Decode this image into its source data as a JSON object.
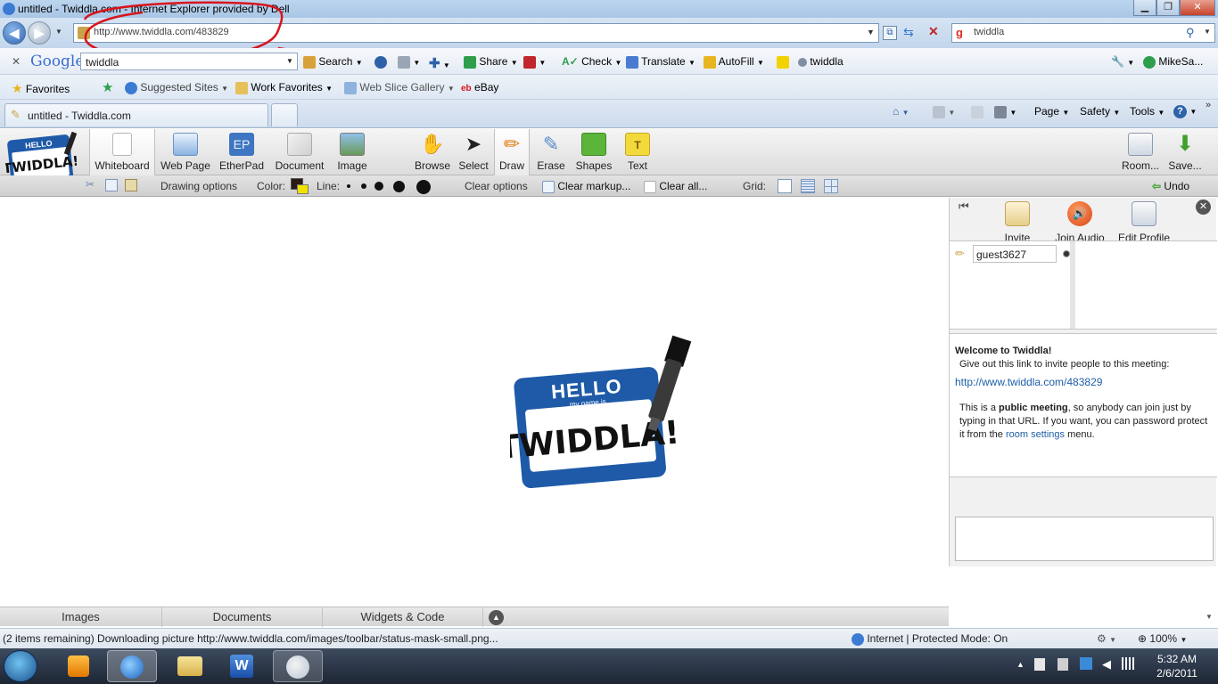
{
  "window": {
    "title": "untitled - Twiddla.com - Internet Explorer provided by Dell",
    "controls": [
      "minimize",
      "restore",
      "close"
    ]
  },
  "nav": {
    "url": "http://www.twiddla.com/483829",
    "search_value": "twiddla"
  },
  "google_toolbar": {
    "close": "✕",
    "brand": "Google",
    "query": "twiddla",
    "search_label": "Search",
    "share_label": "Share",
    "check_label": "Check",
    "translate_label": "Translate",
    "autofill_label": "AutoFill",
    "bookmark_label": "twiddla",
    "user_label": "MikeSa..."
  },
  "favorites_bar": {
    "favorites_label": "Favorites",
    "items": [
      "Suggested Sites",
      "Work Favorites",
      "Web Slice Gallery",
      "eBay"
    ]
  },
  "tabs": {
    "active_tab": "untitled - Twiddla.com",
    "commands": [
      "Page",
      "Safety",
      "Tools"
    ]
  },
  "twiddla_toolbar": {
    "logo_text": "HELLO TWIDDLA!",
    "modes": [
      "Whiteboard",
      "Web Page",
      "EtherPad",
      "Document",
      "Image"
    ],
    "tools": [
      "Browse",
      "Select",
      "Draw",
      "Erase",
      "Shapes",
      "Text"
    ],
    "ep_icon_text": "EP",
    "text_icon_text": "T",
    "room_label": "Room...",
    "save_label": "Save..."
  },
  "options_bar": {
    "drawing_options": "Drawing options",
    "color_label": "Color:",
    "line_label": "Line:",
    "clear_options": "Clear options",
    "clear_markup": "Clear markup...",
    "clear_all": "Clear all...",
    "grid_label": "Grid:",
    "undo_label": "Undo"
  },
  "canvas_logo": {
    "hello": "HELLO",
    "my_name_is": "my name is",
    "name": "TWIDDLA!"
  },
  "bottom_tabs": [
    "Images",
    "Documents",
    "Widgets & Code"
  ],
  "right_panel": {
    "invite_label": "Invite",
    "join_audio_label": "Join Audio",
    "edit_profile_label": "Edit Profile",
    "guest_name": "guest3627",
    "welcome_title": "Welcome to Twiddla!",
    "invite_text": "Give out this link to invite people to this meeting:",
    "meeting_link": "http://www.twiddla.com/483829",
    "public_pre": "This is a ",
    "public_bold": "public meeting",
    "public_post": ", so anybody can join just by typing in that URL. If you want, you can password protect it from the ",
    "room_settings": "room settings",
    "menu_word": "menu."
  },
  "status_bar": {
    "message": "(2 items remaining) Downloading picture http://www.twiddla.com/images/toolbar/status-mask-small.png...",
    "zone": "Internet | Protected Mode: On",
    "zoom": "100%"
  },
  "taskbar": {
    "time": "5:32 AM",
    "date": "2/6/2011"
  },
  "colors": {
    "twiddla_blue": "#1e5aa8",
    "link_blue": "#1f5ea8",
    "annotation_red": "#d8141c"
  }
}
